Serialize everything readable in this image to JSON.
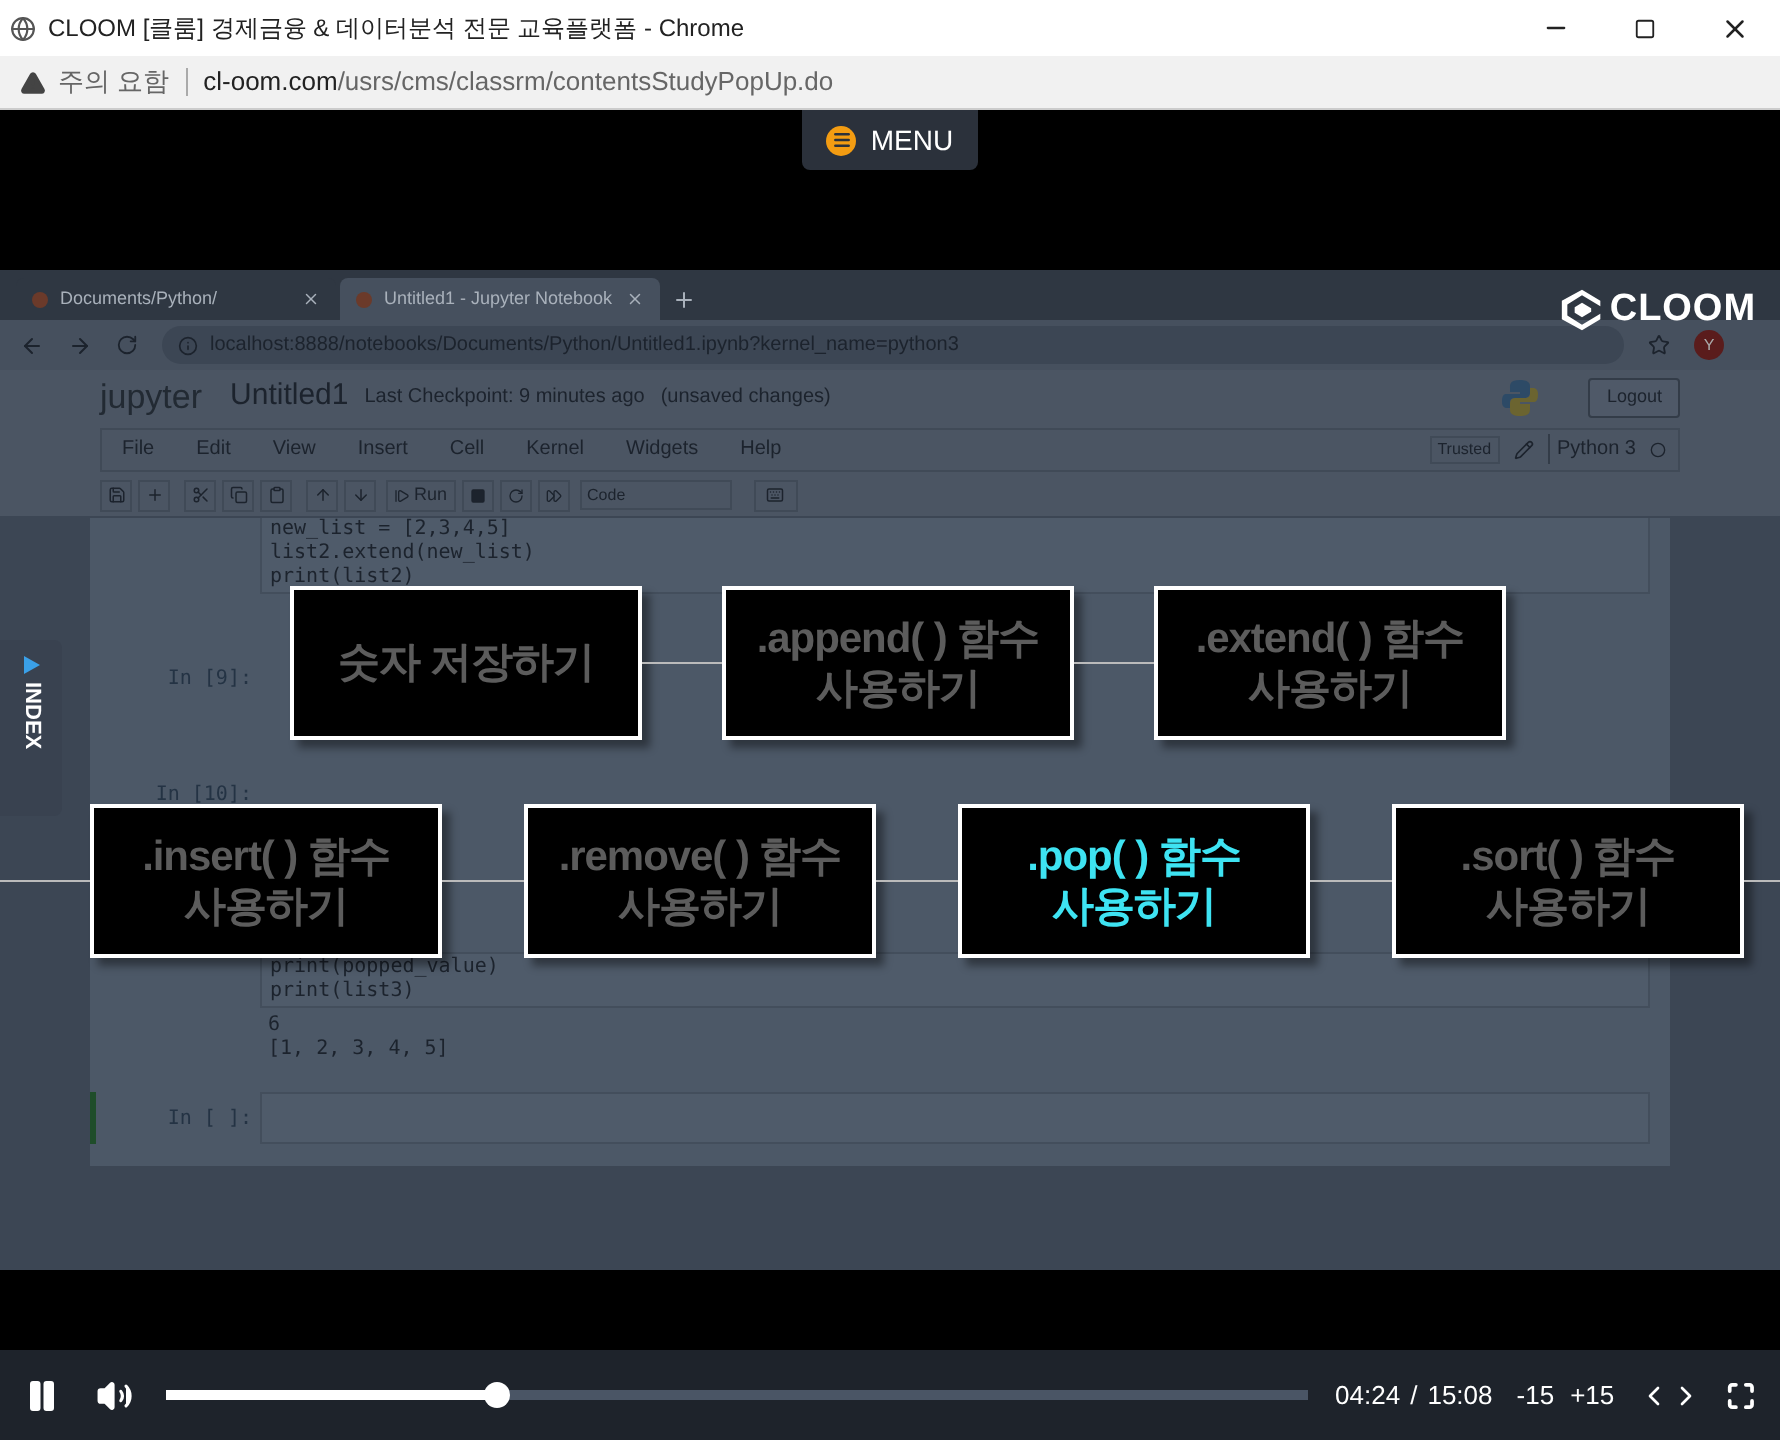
{
  "window": {
    "title": "CLOOM [클룸] 경제금융 & 데이터분석 전문 교육플랫폼 - Chrome"
  },
  "address_bar": {
    "warning": "주의 요함",
    "url_host": "cl-oom.com",
    "url_path": "/usrs/cms/classrm/contentsStudyPopUp.do"
  },
  "menu_button": {
    "label": "MENU"
  },
  "index_tab": {
    "label": "INDEX"
  },
  "video": {
    "logo": "CLOOM",
    "browser_tabs": [
      {
        "title": "Documents/Python/",
        "selected": false
      },
      {
        "title": "Untitled1 - Jupyter Notebook",
        "selected": true
      }
    ],
    "url": "localhost:8888/notebooks/Documents/Python/Untitled1.ipynb?kernel_name=python3",
    "avatar": "Y",
    "jupyter": {
      "brand": "jupyter",
      "notebook": "Untitled1",
      "checkpoint": "Last Checkpoint: 9 minutes ago",
      "status": "(unsaved changes)",
      "logout": "Logout",
      "menu": [
        "File",
        "Edit",
        "View",
        "Insert",
        "Cell",
        "Kernel",
        "Widgets",
        "Help"
      ],
      "trusted": "Trusted",
      "kernel": "Python 3",
      "run": "Run",
      "cell_type": "Code"
    },
    "cells": [
      {
        "lines": [
          "new_list = [2,3,4,5]",
          "list2.extend(new_list)",
          "print(list2)"
        ],
        "selected": false
      },
      {
        "prompt": "In [9]:",
        "selected": false
      },
      {
        "prompt": "In [10]:",
        "selected": false
      },
      {
        "lines": [
          "print(popped_value)",
          "print(list3)"
        ],
        "output": [
          "6",
          "[1, 2, 3, 4, 5]"
        ],
        "selected": false
      },
      {
        "prompt": "In [ ]:",
        "selected": true
      }
    ],
    "steps": [
      {
        "lines": [
          "숫자 저장하기"
        ],
        "selected": false
      },
      {
        "lines": [
          ".append( ) 함수",
          "사용하기"
        ],
        "selected": false
      },
      {
        "lines": [
          ".extend( ) 함수",
          "사용하기"
        ],
        "selected": false
      },
      {
        "lines": [
          ".insert( ) 함수",
          "사용하기"
        ],
        "selected": false
      },
      {
        "lines": [
          ".remove( ) 함수",
          "사용하기"
        ],
        "selected": false
      },
      {
        "lines": [
          ".pop( ) 함수",
          "사용하기"
        ],
        "selected": true
      },
      {
        "lines": [
          ".sort( ) 함수",
          "사용하기"
        ],
        "selected": false
      }
    ]
  },
  "player": {
    "playing": true,
    "level": 0.29,
    "current": "04:24",
    "separator": "/",
    "total": "15:08",
    "back": "-15",
    "forward": "+15"
  }
}
